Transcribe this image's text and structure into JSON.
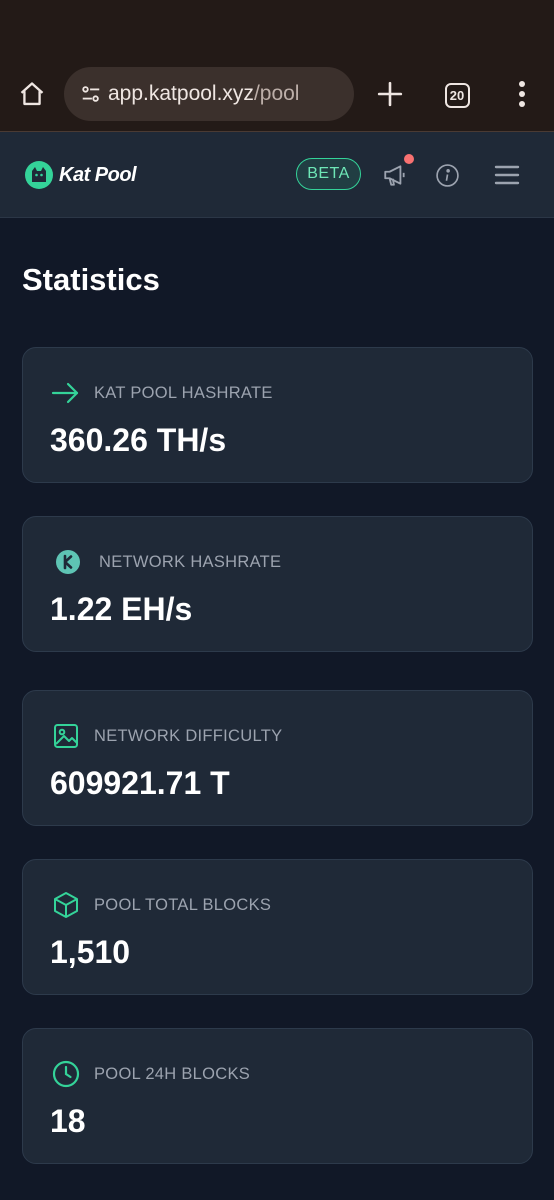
{
  "browser": {
    "url_host": "app.katpool.xyz",
    "url_path": "/pool",
    "tab_count": "20",
    "icons": [
      "home-icon",
      "site-settings-icon",
      "new-tab-icon",
      "tab-switcher-icon",
      "more-vert-icon"
    ]
  },
  "header": {
    "logo_text": "Kat Pool",
    "beta_label": "BETA",
    "accent_color": "#34d399",
    "notification_dot_color": "#f87171",
    "icons": [
      "kat-logo-icon",
      "megaphone-icon",
      "info-icon",
      "hamburger-menu-icon"
    ]
  },
  "main": {
    "title": "Statistics",
    "cards": [
      {
        "label": "KAT POOL HASHRATE",
        "value": "360.26 TH/s",
        "icon": "arrow-right-icon"
      },
      {
        "label": "NETWORK HASHRATE",
        "value": "1.22 EH/s",
        "icon": "kaspa-logo-icon"
      },
      {
        "label": "NETWORK DIFFICULTY",
        "value": "609921.71 T",
        "icon": "image-icon"
      },
      {
        "label": "POOL TOTAL BLOCKS",
        "value": "1,510",
        "icon": "cube-icon"
      },
      {
        "label": "POOL 24H BLOCKS",
        "value": "18",
        "icon": "clock-icon"
      }
    ]
  }
}
